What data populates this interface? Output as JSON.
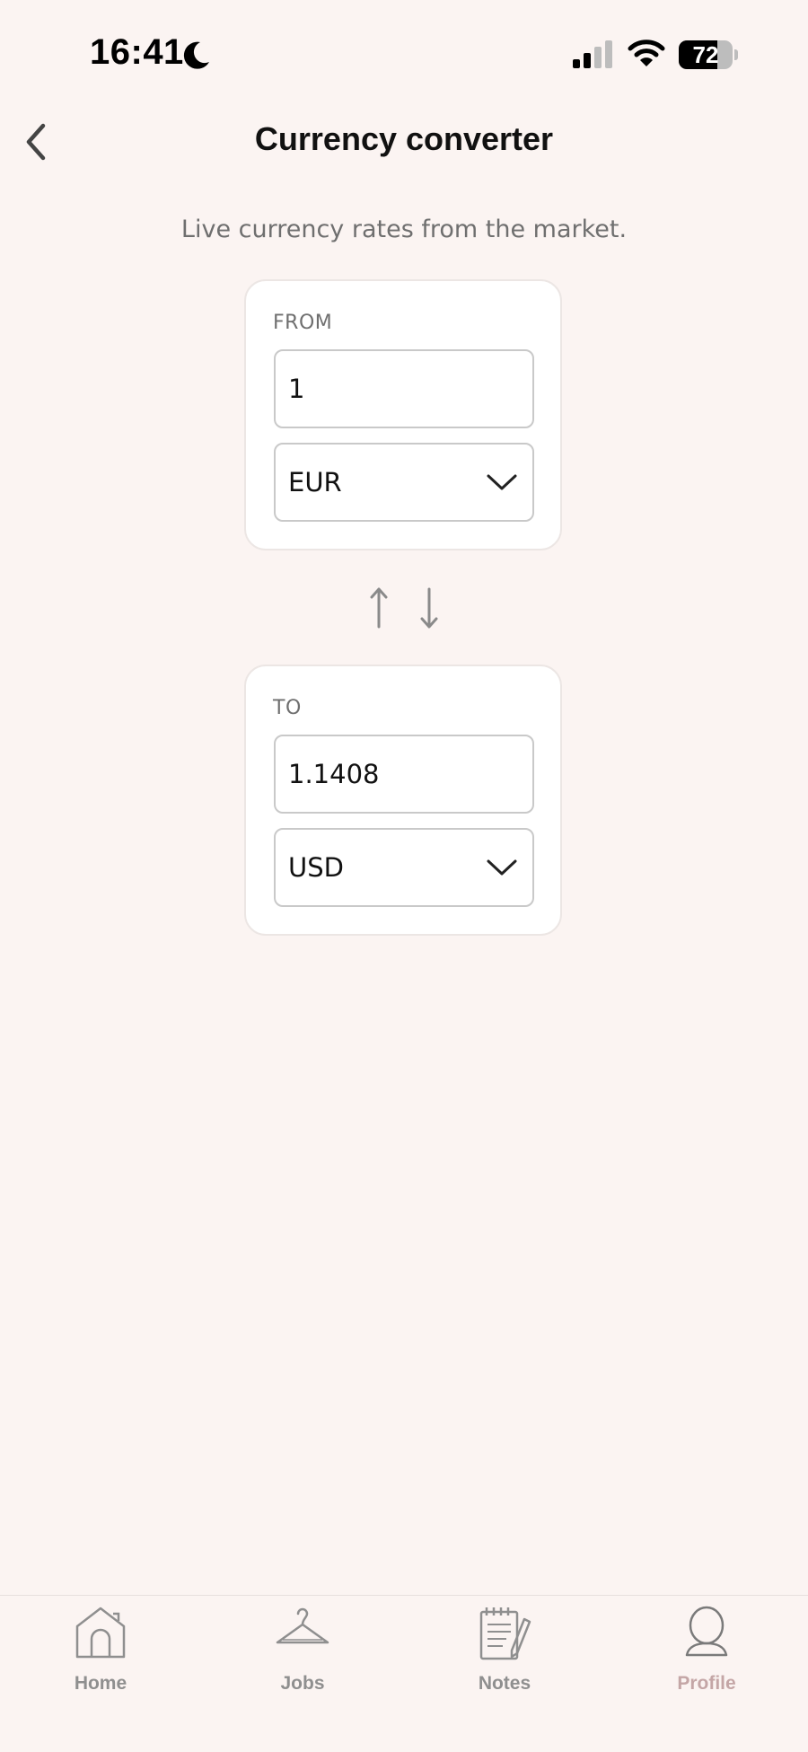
{
  "status_bar": {
    "time": "16:41",
    "battery_level": 72,
    "battery_label": "72",
    "icons": [
      "moon-icon",
      "cellular-signal-icon",
      "wifi-icon",
      "battery-icon"
    ]
  },
  "header": {
    "title": "Currency converter",
    "back_icon": "chevron-left-icon"
  },
  "subtitle": "Live currency rates from the market.",
  "from": {
    "label": "FROM",
    "amount": "1",
    "currency": "EUR"
  },
  "swap": {
    "icons": [
      "arrow-up-icon",
      "arrow-down-icon"
    ]
  },
  "to": {
    "label": "TO",
    "amount": "1.1408",
    "currency": "USD"
  },
  "bottom_nav": {
    "items": [
      {
        "label": "Home",
        "icon": "home-icon",
        "active": false
      },
      {
        "label": "Jobs",
        "icon": "hanger-icon",
        "active": false
      },
      {
        "label": "Notes",
        "icon": "notepad-icon",
        "active": false
      },
      {
        "label": "Profile",
        "icon": "profile-icon",
        "active": true
      }
    ]
  },
  "colors": {
    "background": "#FBF4F2",
    "card": "#FFFFFF",
    "card_border": "#ECE6E4",
    "field_border": "#C9C9C9",
    "muted_text": "#6F6F6F",
    "nav_inactive": "#8F8F8F",
    "nav_active": "#C4A6A6"
  }
}
